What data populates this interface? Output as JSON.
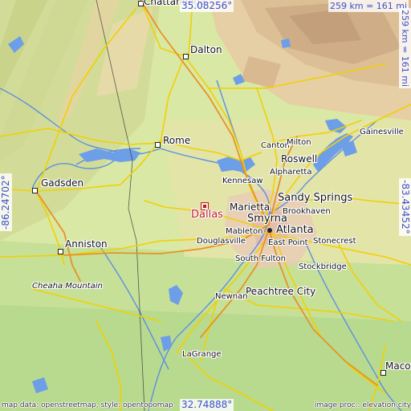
{
  "map": {
    "target_city": "Dallas",
    "coordinates": {
      "top_lat": "35.08256°",
      "bottom_lat": "32.74888°",
      "left_lon": "-86.24702°",
      "right_lon": "-83.43452°"
    },
    "scale_top": "259 km = 161 mi",
    "scale_right": "259 km = 161 mi",
    "credit_left": "map data: openstreetmap, style: opentopomap",
    "credit_right": "image proc.: elevation.city",
    "places": [
      {
        "label": "Chattanooga",
        "style": "normal"
      },
      {
        "label": "Dalton",
        "style": "normal"
      },
      {
        "label": "Rome",
        "style": "normal"
      },
      {
        "label": "Canton",
        "style": "small"
      },
      {
        "label": "Milton",
        "style": "small"
      },
      {
        "label": "Gainesville",
        "style": "small"
      },
      {
        "label": "Roswell",
        "style": "normal"
      },
      {
        "label": "Alpharetta",
        "style": "small"
      },
      {
        "label": "Kennesaw",
        "style": "small"
      },
      {
        "label": "Sandy Springs",
        "style": "big"
      },
      {
        "label": "Gadsden",
        "style": "normal"
      },
      {
        "label": "Marietta",
        "style": "normal"
      },
      {
        "label": "Smyrna",
        "style": "big"
      },
      {
        "label": "Brookhaven",
        "style": "small"
      },
      {
        "label": "Mableton",
        "style": "small"
      },
      {
        "label": "Atlanta",
        "style": "big"
      },
      {
        "label": "Douglasville",
        "style": "small"
      },
      {
        "label": "East Point",
        "style": "small"
      },
      {
        "label": "Stonecrest",
        "style": "small"
      },
      {
        "label": "Anniston",
        "style": "normal"
      },
      {
        "label": "South Fulton",
        "style": "small"
      },
      {
        "label": "Stockbridge",
        "style": "small"
      },
      {
        "label": "Cheaha Mountain",
        "style": "italic"
      },
      {
        "label": "Peachtree City",
        "style": "normal"
      },
      {
        "label": "Newnan",
        "style": "small"
      },
      {
        "label": "LaGrange",
        "style": "small"
      },
      {
        "label": "Macon",
        "style": "normal"
      }
    ]
  }
}
